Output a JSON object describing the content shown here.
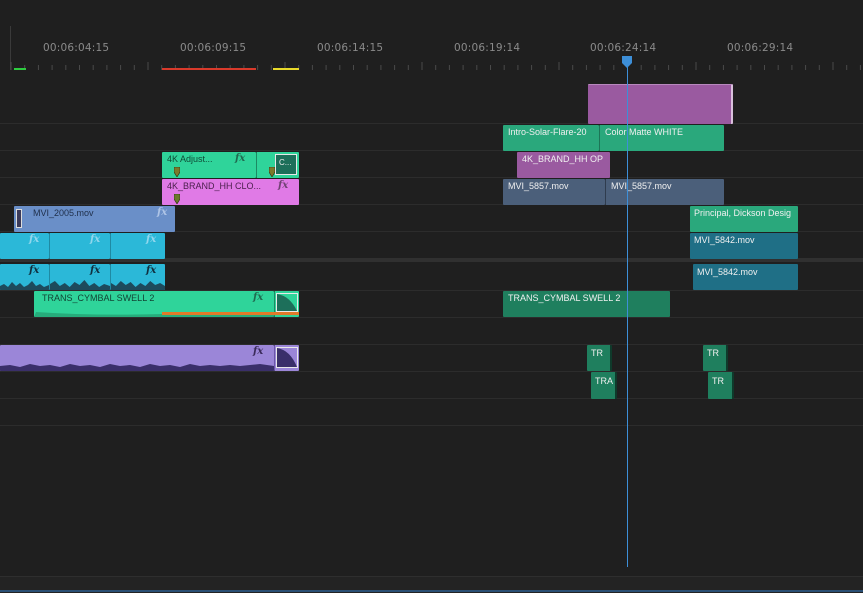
{
  "ruler": {
    "timecodes": [
      "00:06:04:15",
      "00:06:09:15",
      "00:06:14:15",
      "00:06:19:14",
      "00:06:24:14",
      "00:06:29:14"
    ]
  },
  "colors": {
    "marker_green": "#2ecc40",
    "marker_red": "#d93a2b",
    "marker_yellow": "#e8d92a",
    "playhead": "#3d8fd8",
    "clip_teal": "#2aa87c",
    "clip_green": "#2fd49a",
    "clip_pink": "#e07ae6",
    "clip_purple": "#9a5aa0",
    "clip_blue": "#6a8fc8",
    "clip_slate": "#4b5f7a",
    "clip_cyan": "#2bb8d8",
    "clip_dark_teal": "#1f6f86",
    "clip_lavender": "#9b86d8",
    "audio_highlight": "#e07a2a"
  },
  "clips": {
    "adjust": "4K Adjust...",
    "adjust_c": "C...",
    "brand_hh_clo": "4K_BRAND_HH CLO...",
    "mvi_2005": "MVI_2005.mov",
    "trans_cymbal_1": "TRANS_CYMBAL SWELL 2",
    "intro_solar": "Intro-Solar-Flare-20",
    "color_matte": "Color Matte WHITE",
    "brand_hh_op": "4K_BRAND_HH OP",
    "mvi_5857_a": "MVI_5857.mov",
    "mvi_5857_b": "MVI_5857.mov",
    "principal": "Principal, Dickson Desig",
    "mvi_5842_v": "MVI_5842.mov",
    "mvi_5842_a": "MVI_5842.mov",
    "trans_cymbal_2": "TRANS_CYMBAL SWELL 2",
    "tr_1": "TR",
    "tra_1": "TRA",
    "tr_2": "TR",
    "tr_3": "TR"
  },
  "fx_label": "fx"
}
